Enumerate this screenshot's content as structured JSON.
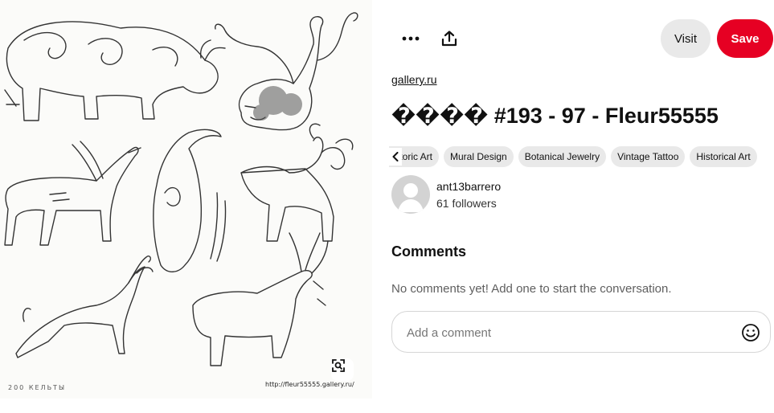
{
  "pin": {
    "image_footer_text": "200  КЕЛЬТЫ",
    "image_watermark": "http://fleur55555.gallery.ru/"
  },
  "toolbar": {
    "more_icon": "ellipsis-icon",
    "share_icon": "share-upload-icon",
    "visit_label": "Visit",
    "save_label": "Save"
  },
  "source": {
    "domain": "gallery.ru"
  },
  "title": "���� #193 - 97 - Fleur55555",
  "tags": [
    "Historic Art",
    "Mural Design",
    "Botanical Jewelry",
    "Vintage Tattoo",
    "Historical Art"
  ],
  "author": {
    "name": "ant13barrero",
    "followers": "61 followers"
  },
  "comments": {
    "heading": "Comments",
    "empty_text": "No comments yet! Add one to start the conversation.",
    "input_placeholder": "Add a comment"
  },
  "colors": {
    "save": "#e60023",
    "visit_bg": "#e9e9e9",
    "chip_bg": "#e9e9e9"
  }
}
